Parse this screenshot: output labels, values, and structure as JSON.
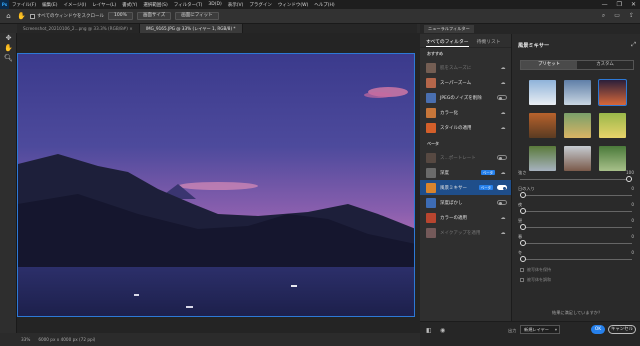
{
  "app": {
    "logo": "Ps"
  },
  "menu": [
    "ファイル(F)",
    "編集(E)",
    "イメージ(I)",
    "レイヤー(L)",
    "書式(Y)",
    "選択範囲(S)",
    "フィルター(T)",
    "3D(D)",
    "表示(V)",
    "プラグイン",
    "ウィンドウ(W)",
    "ヘルプ(H)"
  ],
  "window_controls": {
    "minimize": "—",
    "restore": "❐",
    "close": "✕"
  },
  "options": {
    "scroll_all_label": "すべてのウィンドウをスクロール",
    "zoom_btn": "100%",
    "fit_screen_btn": "画面サイズ",
    "fill_screen_btn": "画面にフィット"
  },
  "tabs": [
    {
      "label": "Screenshot_20210106_2...png @ 33.3% (RGB/8#) ×"
    },
    {
      "label": "IMG_9165.JPG @ 33% (レイヤー 1, RGB/8) *"
    }
  ],
  "status": {
    "zoom": "33%",
    "info": "6000 px x 4000 px (72 ppi)"
  },
  "neural_filters": {
    "panel_title": "ニューラルフィルター",
    "tab_all": "すべてのフィルター",
    "tab_wait": "待機リスト",
    "section_featured": "おすすめ",
    "section_beta": "ベータ",
    "featured": [
      {
        "label": "肌をスムーズに",
        "dim": true,
        "thumb": "#c99a80",
        "state": "cloud"
      },
      {
        "label": "スーパーズーム",
        "dim": false,
        "thumb": "#b5664a",
        "state": "cloud"
      },
      {
        "label": "JPEGのノイズを削除",
        "dim": false,
        "thumb": "#4a6fb0",
        "state": "toggle-off"
      },
      {
        "label": "カラー化",
        "dim": false,
        "thumb": "#c7763a",
        "state": "cloud"
      },
      {
        "label": "スタイルの適用",
        "dim": false,
        "thumb": "#d35f2a",
        "state": "cloud"
      }
    ],
    "beta": [
      {
        "label": "ス...ポートレート",
        "dim": true,
        "thumb": "#8a6a5a",
        "state": "toggle-off",
        "beta": ""
      },
      {
        "label": "深度",
        "dim": false,
        "thumb": "#6a6a6a",
        "state": "cloud",
        "beta": "ベータ"
      },
      {
        "label": "風景ミキサー",
        "dim": false,
        "thumb": "#d8842e",
        "state": "toggle-on",
        "beta": "ベータ",
        "selected": true
      },
      {
        "label": "深度ぼかし",
        "dim": false,
        "thumb": "#3d6cb5",
        "state": "toggle-off",
        "beta": ""
      },
      {
        "label": "カラーの適用",
        "dim": false,
        "thumb": "#b8452f",
        "state": "cloud",
        "beta": ""
      },
      {
        "label": "メイクアップを適用",
        "dim": true,
        "thumb": "#c98e8e",
        "state": "cloud",
        "beta": ""
      }
    ]
  },
  "landscape_mixer": {
    "title": "風景ミキサー",
    "seg_preset": "プリセット",
    "seg_custom": "カスタム",
    "presets": [
      {
        "a": "#8fb3d9",
        "b": "#e9eef2",
        "selected": false
      },
      {
        "a": "#5f7fa8",
        "b": "#c9d6e2",
        "selected": false
      },
      {
        "a": "#2b1f3a",
        "b": "#d6683a",
        "selected": true
      },
      {
        "a": "#b8622c",
        "b": "#5a3b22",
        "selected": false
      },
      {
        "a": "#7aa06a",
        "b": "#d9b464",
        "selected": false
      },
      {
        "a": "#9ab84a",
        "b": "#e8d36a",
        "selected": false
      },
      {
        "a": "#5a7a3a",
        "b": "#a7b2bf",
        "selected": false
      },
      {
        "a": "#c6ccd2",
        "b": "#7a5a4a",
        "selected": false
      },
      {
        "a": "#4a7a3a",
        "b": "#a8c08a",
        "selected": false
      }
    ],
    "sliders": [
      {
        "label": "強さ",
        "value": "100",
        "pos": 1.0
      },
      {
        "label": "日の入り",
        "value": "0",
        "pos": 0.0
      },
      {
        "label": "夜",
        "value": "0",
        "pos": 0.0
      },
      {
        "label": "昼",
        "value": "0",
        "pos": 0.0
      },
      {
        "label": "春",
        "value": "0",
        "pos": 0.0
      },
      {
        "label": "冬",
        "value": "0",
        "pos": 0.0
      }
    ],
    "checkbox_preserve": "被写体を保持",
    "checkbox_harmonize": "被写体を調和",
    "feedback": "結果に満足していますか？"
  },
  "footer": {
    "output_label": "出力",
    "output_value": "新規レイヤー",
    "ok": "OK",
    "cancel": "キャンセル"
  },
  "colors": {
    "accent": "#2680eb",
    "selected_row": "#1f4e8a",
    "frame": "#2d79d6"
  }
}
